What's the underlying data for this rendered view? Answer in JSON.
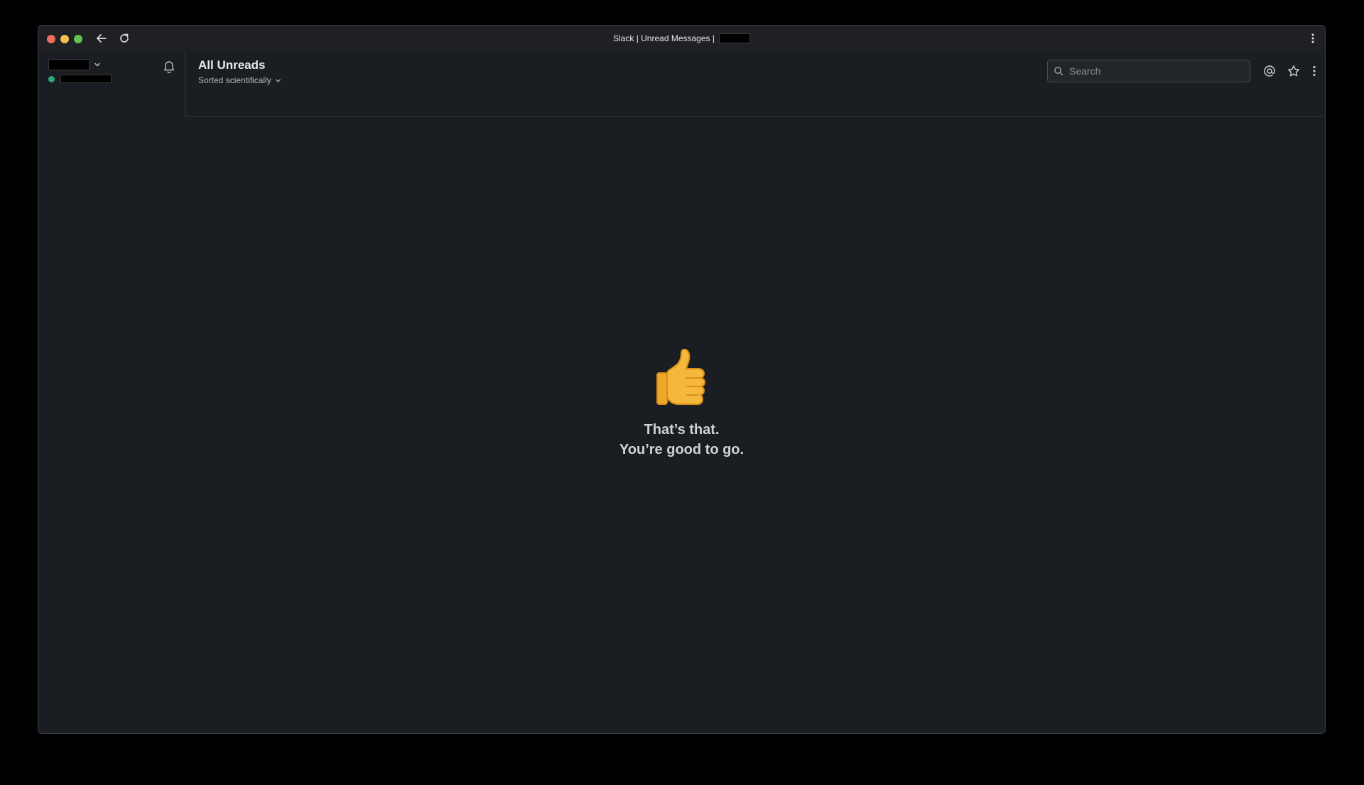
{
  "window": {
    "title": "Slack | Unread Messages |"
  },
  "header": {
    "title": "All Unreads",
    "sort_label": "Sorted scientifically"
  },
  "search": {
    "placeholder": "Search"
  },
  "empty_state": {
    "line1": "That’s that.",
    "line2": "You’re good to go."
  },
  "colors": {
    "background": "#1a1d21",
    "presence": "#2bac76",
    "text": "#d1d2d3"
  },
  "icons": [
    "back-arrow-icon",
    "reload-icon",
    "kebab-icon",
    "chevron-down-icon",
    "bell-icon",
    "search-icon",
    "at-icon",
    "star-icon",
    "thumbs-up-icon"
  ]
}
